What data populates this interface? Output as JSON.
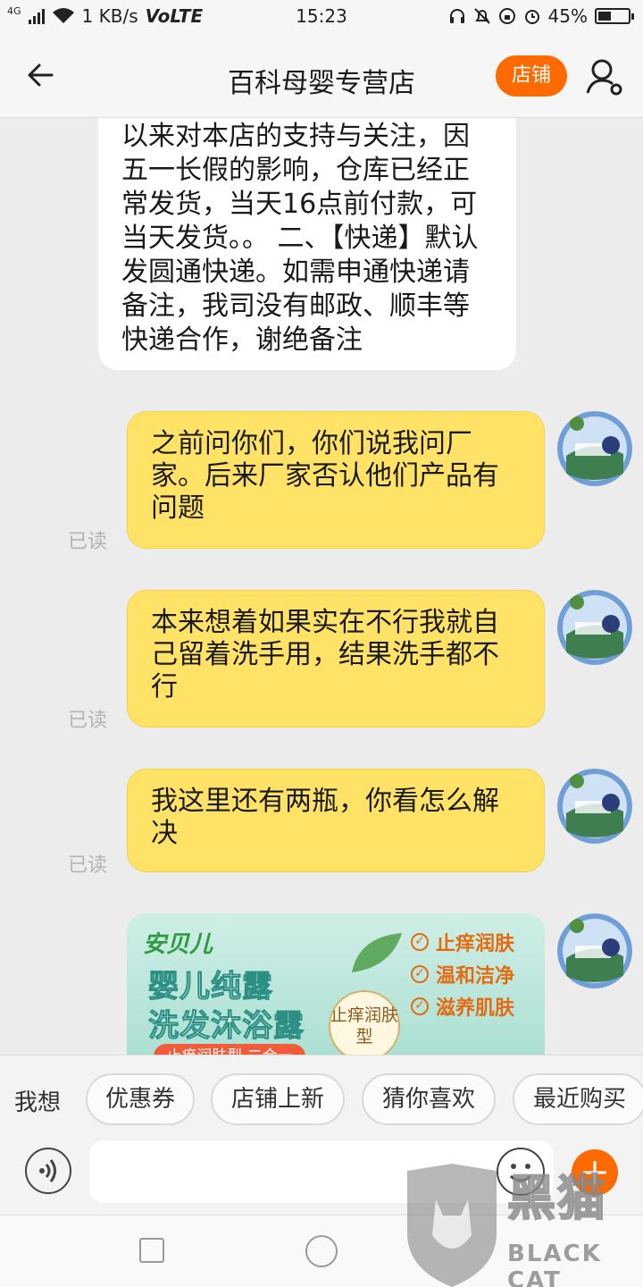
{
  "status_bar": {
    "network_type": "4G",
    "speed": "1 KB/s",
    "volte": "VoLTE",
    "time": "15:23",
    "battery": "45%",
    "battery_level": 0.45,
    "icons": [
      "headset-icon",
      "mute-icon",
      "rotation-lock-icon",
      "alarm-icon"
    ]
  },
  "header": {
    "title": "百科母婴专营店",
    "shop_label": "店铺",
    "accent_color": "#ff6a00"
  },
  "messages": [
    {
      "direction": "incoming",
      "text": "以来对本店的支持与关注，因五一长假的影响，仓库已经正常发货，当天16点前付款，可当天发货。。 二、【快递】默认发圆通快递。如需申通快递请备注，我司没有邮政、顺丰等快递合作，谢绝备注"
    },
    {
      "direction": "outgoing",
      "text": "之前问你们，你们说我问厂家。后来厂家否认他们产品有问题",
      "status": "已读"
    },
    {
      "direction": "outgoing",
      "text": "本来想着如果实在不行我就自己留着洗手用，结果洗手都不行",
      "status": "已读"
    },
    {
      "direction": "outgoing",
      "text": "我这里还有两瓶，你看怎么解决",
      "status": "已读"
    },
    {
      "direction": "outgoing",
      "type": "image",
      "product": {
        "brand": "安贝儿",
        "line1": "婴儿纯露",
        "line2": "洗发沐浴露",
        "features": [
          "止痒润肤",
          "温和洁净",
          "滋养肌肤"
        ],
        "badge": "止痒润肤型",
        "strip": "止痒润肤型 二合一"
      }
    }
  ],
  "suggestions": {
    "label": "我想",
    "chips": [
      "优惠券",
      "店铺上新",
      "猜你喜欢",
      "最近购买"
    ]
  },
  "input": {
    "placeholder": ""
  },
  "watermark": {
    "text": "黑猫",
    "sub": "BLACK CAT"
  }
}
